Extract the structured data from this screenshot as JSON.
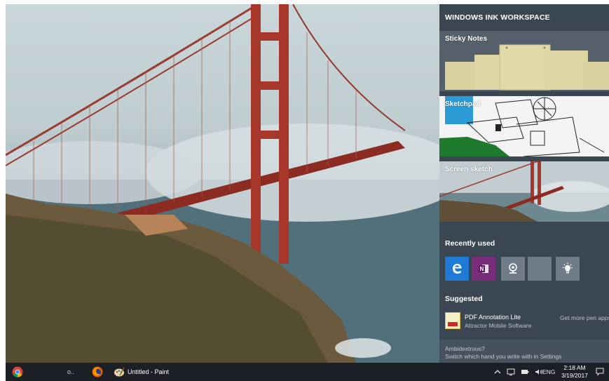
{
  "ink_workspace": {
    "title": "WINDOWS INK WORKSPACE",
    "tiles": {
      "sticky_notes": "Sticky Notes",
      "sketchpad": "Sketchpad",
      "screen_sketch": "Screen sketch"
    },
    "recently_used": {
      "heading": "Recently used",
      "apps": [
        "edge-icon",
        "onenote-icon",
        "maps-icon",
        "blank-app-icon",
        "tips-icon"
      ]
    },
    "suggested": {
      "heading": "Suggested",
      "app_name": "PDF Annotation Lite",
      "publisher": "Attractor Mobile Software",
      "more_link": "Get more pen apps"
    },
    "ambidextrous": {
      "line1": "Ambidextrous?",
      "line2": "Switch which hand you write with in Settings"
    }
  },
  "taskbar": {
    "misc_label": "o..",
    "paint_label": "Untitled - Paint",
    "language": "ENG",
    "time": "2:18 AM",
    "date": "3/19/2017",
    "tray_icons": [
      "chevron-up-icon",
      "pen-tray-icon",
      "battery-icon",
      "volume-icon"
    ]
  },
  "colors": {
    "panel_bg": "#3b4653",
    "edge_blue": "#1e7ad4",
    "onenote_purple": "#7a2d7a",
    "taskbar": "#1c1f26"
  }
}
